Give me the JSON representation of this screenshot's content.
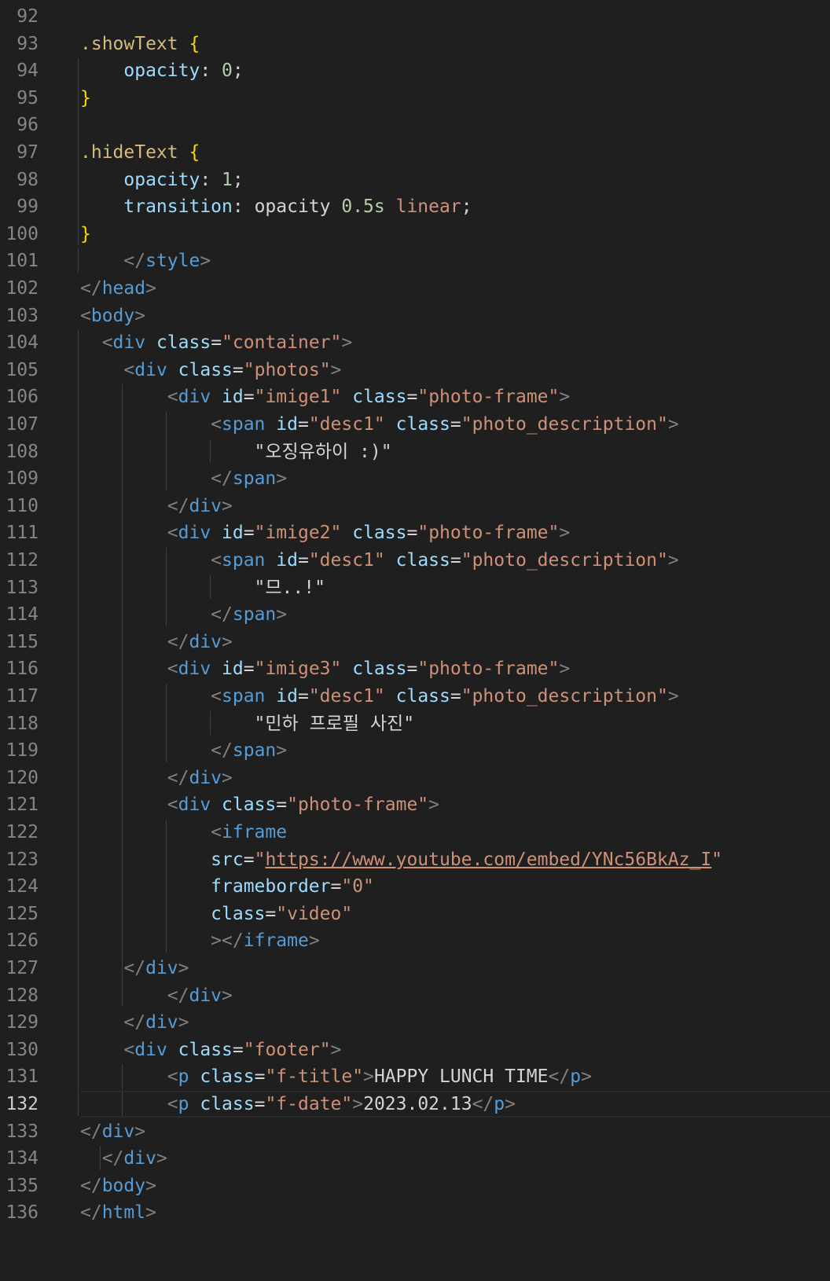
{
  "editor": {
    "active_line": "132",
    "lines": [
      {
        "n": "92",
        "t": []
      },
      {
        "n": "93",
        "t": [
          [
            "sel",
            ".showText "
          ],
          [
            "br",
            "{"
          ]
        ]
      },
      {
        "n": "94",
        "t": [
          [
            "prop",
            "    opacity"
          ],
          [
            "txt",
            ": "
          ],
          [
            "num",
            "0"
          ],
          [
            "txt",
            ";"
          ]
        ]
      },
      {
        "n": "95",
        "t": [
          [
            "br",
            "}"
          ]
        ]
      },
      {
        "n": "96",
        "t": []
      },
      {
        "n": "97",
        "t": [
          [
            "sel",
            ".hideText "
          ],
          [
            "br",
            "{"
          ]
        ]
      },
      {
        "n": "98",
        "t": [
          [
            "prop",
            "    opacity"
          ],
          [
            "txt",
            ": "
          ],
          [
            "num",
            "1"
          ],
          [
            "txt",
            ";"
          ]
        ]
      },
      {
        "n": "99",
        "t": [
          [
            "prop",
            "    transition"
          ],
          [
            "txt",
            ": opacity "
          ],
          [
            "num",
            "0.5s"
          ],
          [
            "txt",
            " "
          ],
          [
            "val",
            "linear"
          ],
          [
            "txt",
            ";"
          ]
        ]
      },
      {
        "n": "100",
        "t": [
          [
            "br",
            "}"
          ]
        ]
      },
      {
        "n": "101",
        "t": [
          [
            "pun",
            "    </"
          ],
          [
            "tag",
            "style"
          ],
          [
            "pun",
            ">"
          ]
        ]
      },
      {
        "n": "102",
        "t": [
          [
            "pun",
            "</"
          ],
          [
            "tag",
            "head"
          ],
          [
            "pun",
            ">"
          ]
        ]
      },
      {
        "n": "103",
        "t": [
          [
            "pun",
            "<"
          ],
          [
            "tag",
            "body"
          ],
          [
            "pun",
            ">"
          ]
        ]
      },
      {
        "n": "104",
        "t": [
          [
            "pun",
            "  <"
          ],
          [
            "tag",
            "div"
          ],
          [
            "txt",
            " "
          ],
          [
            "att",
            "class"
          ],
          [
            "txt",
            "="
          ],
          [
            "str",
            "\"container\""
          ],
          [
            "pun",
            ">"
          ]
        ]
      },
      {
        "n": "105",
        "t": [
          [
            "pun",
            "    <"
          ],
          [
            "tag",
            "div"
          ],
          [
            "txt",
            " "
          ],
          [
            "att",
            "class"
          ],
          [
            "txt",
            "="
          ],
          [
            "str",
            "\"photos\""
          ],
          [
            "pun",
            ">"
          ]
        ]
      },
      {
        "n": "106",
        "t": [
          [
            "pun",
            "        <"
          ],
          [
            "tag",
            "div"
          ],
          [
            "txt",
            " "
          ],
          [
            "att",
            "id"
          ],
          [
            "txt",
            "="
          ],
          [
            "str",
            "\"imige1\""
          ],
          [
            "txt",
            " "
          ],
          [
            "att",
            "class"
          ],
          [
            "txt",
            "="
          ],
          [
            "str",
            "\"photo-frame\""
          ],
          [
            "pun",
            ">"
          ]
        ]
      },
      {
        "n": "107",
        "t": [
          [
            "pun",
            "            <"
          ],
          [
            "tag",
            "span"
          ],
          [
            "txt",
            " "
          ],
          [
            "att",
            "id"
          ],
          [
            "txt",
            "="
          ],
          [
            "str",
            "\"desc1\""
          ],
          [
            "txt",
            " "
          ],
          [
            "att",
            "class"
          ],
          [
            "txt",
            "="
          ],
          [
            "str",
            "\"photo_description\""
          ],
          [
            "pun",
            ">"
          ]
        ]
      },
      {
        "n": "108",
        "t": [
          [
            "txt",
            "                \"오징유하이 :)\""
          ]
        ]
      },
      {
        "n": "109",
        "t": [
          [
            "pun",
            "            </"
          ],
          [
            "tag",
            "span"
          ],
          [
            "pun",
            ">"
          ]
        ]
      },
      {
        "n": "110",
        "t": [
          [
            "pun",
            "        </"
          ],
          [
            "tag",
            "div"
          ],
          [
            "pun",
            ">"
          ]
        ]
      },
      {
        "n": "111",
        "t": [
          [
            "pun",
            "        <"
          ],
          [
            "tag",
            "div"
          ],
          [
            "txt",
            " "
          ],
          [
            "att",
            "id"
          ],
          [
            "txt",
            "="
          ],
          [
            "str",
            "\"imige2\""
          ],
          [
            "txt",
            " "
          ],
          [
            "att",
            "class"
          ],
          [
            "txt",
            "="
          ],
          [
            "str",
            "\"photo-frame\""
          ],
          [
            "pun",
            ">"
          ]
        ]
      },
      {
        "n": "112",
        "t": [
          [
            "pun",
            "            <"
          ],
          [
            "tag",
            "span"
          ],
          [
            "txt",
            " "
          ],
          [
            "att",
            "id"
          ],
          [
            "txt",
            "="
          ],
          [
            "str",
            "\"desc1\""
          ],
          [
            "txt",
            " "
          ],
          [
            "att",
            "class"
          ],
          [
            "txt",
            "="
          ],
          [
            "str",
            "\"photo_description\""
          ],
          [
            "pun",
            ">"
          ]
        ]
      },
      {
        "n": "113",
        "t": [
          [
            "txt",
            "                \"므..!\""
          ]
        ]
      },
      {
        "n": "114",
        "t": [
          [
            "pun",
            "            </"
          ],
          [
            "tag",
            "span"
          ],
          [
            "pun",
            ">"
          ]
        ]
      },
      {
        "n": "115",
        "t": [
          [
            "pun",
            "        </"
          ],
          [
            "tag",
            "div"
          ],
          [
            "pun",
            ">"
          ]
        ]
      },
      {
        "n": "116",
        "t": [
          [
            "pun",
            "        <"
          ],
          [
            "tag",
            "div"
          ],
          [
            "txt",
            " "
          ],
          [
            "att",
            "id"
          ],
          [
            "txt",
            "="
          ],
          [
            "str",
            "\"imige3\""
          ],
          [
            "txt",
            " "
          ],
          [
            "att",
            "class"
          ],
          [
            "txt",
            "="
          ],
          [
            "str",
            "\"photo-frame\""
          ],
          [
            "pun",
            ">"
          ]
        ]
      },
      {
        "n": "117",
        "t": [
          [
            "pun",
            "            <"
          ],
          [
            "tag",
            "span"
          ],
          [
            "txt",
            " "
          ],
          [
            "att",
            "id"
          ],
          [
            "txt",
            "="
          ],
          [
            "str",
            "\"desc1\""
          ],
          [
            "txt",
            " "
          ],
          [
            "att",
            "class"
          ],
          [
            "txt",
            "="
          ],
          [
            "str",
            "\"photo_description\""
          ],
          [
            "pun",
            ">"
          ]
        ]
      },
      {
        "n": "118",
        "t": [
          [
            "txt",
            "                \"민하 프로필 사진\""
          ]
        ]
      },
      {
        "n": "119",
        "t": [
          [
            "pun",
            "            </"
          ],
          [
            "tag",
            "span"
          ],
          [
            "pun",
            ">"
          ]
        ]
      },
      {
        "n": "120",
        "t": [
          [
            "pun",
            "        </"
          ],
          [
            "tag",
            "div"
          ],
          [
            "pun",
            ">"
          ]
        ]
      },
      {
        "n": "121",
        "t": [
          [
            "pun",
            "        <"
          ],
          [
            "tag",
            "div"
          ],
          [
            "txt",
            " "
          ],
          [
            "att",
            "class"
          ],
          [
            "txt",
            "="
          ],
          [
            "str",
            "\"photo-frame\""
          ],
          [
            "pun",
            ">"
          ]
        ]
      },
      {
        "n": "122",
        "t": [
          [
            "pun",
            "            <"
          ],
          [
            "tag",
            "iframe"
          ]
        ]
      },
      {
        "n": "123",
        "t": [
          [
            "att",
            "            src"
          ],
          [
            "txt",
            "="
          ],
          [
            "str",
            "\""
          ],
          [
            "url",
            "https://www.youtube.com/embed/YNc56BkAz_I"
          ],
          [
            "str",
            "\""
          ]
        ]
      },
      {
        "n": "124",
        "t": [
          [
            "att",
            "            frameborder"
          ],
          [
            "txt",
            "="
          ],
          [
            "str",
            "\"0\""
          ]
        ]
      },
      {
        "n": "125",
        "t": [
          [
            "att",
            "            class"
          ],
          [
            "txt",
            "="
          ],
          [
            "str",
            "\"video\""
          ]
        ]
      },
      {
        "n": "126",
        "t": [
          [
            "pun",
            "            ></"
          ],
          [
            "tag",
            "iframe"
          ],
          [
            "pun",
            ">"
          ]
        ]
      },
      {
        "n": "127",
        "t": [
          [
            "pun",
            "    </"
          ],
          [
            "tag",
            "div"
          ],
          [
            "pun",
            ">"
          ]
        ]
      },
      {
        "n": "128",
        "t": [
          [
            "pun",
            "        </"
          ],
          [
            "tag",
            "div"
          ],
          [
            "pun",
            ">"
          ]
        ]
      },
      {
        "n": "129",
        "t": [
          [
            "pun",
            "    </"
          ],
          [
            "tag",
            "div"
          ],
          [
            "pun",
            ">"
          ]
        ]
      },
      {
        "n": "130",
        "t": [
          [
            "pun",
            "    <"
          ],
          [
            "tag",
            "div"
          ],
          [
            "txt",
            " "
          ],
          [
            "att",
            "class"
          ],
          [
            "txt",
            "="
          ],
          [
            "str",
            "\"footer\""
          ],
          [
            "pun",
            ">"
          ]
        ]
      },
      {
        "n": "131",
        "t": [
          [
            "pun",
            "        <"
          ],
          [
            "tag",
            "p"
          ],
          [
            "txt",
            " "
          ],
          [
            "att",
            "class"
          ],
          [
            "txt",
            "="
          ],
          [
            "str",
            "\"f-title\""
          ],
          [
            "pun",
            ">"
          ],
          [
            "txt",
            "HAPPY LUNCH TIME"
          ],
          [
            "pun",
            "</"
          ],
          [
            "tag",
            "p"
          ],
          [
            "pun",
            ">"
          ]
        ]
      },
      {
        "n": "132",
        "t": [
          [
            "pun",
            "        <"
          ],
          [
            "tag",
            "p"
          ],
          [
            "txt",
            " "
          ],
          [
            "att",
            "class"
          ],
          [
            "txt",
            "="
          ],
          [
            "str",
            "\"f-date\""
          ],
          [
            "pun",
            ">"
          ],
          [
            "txt",
            "2023.02.13"
          ],
          [
            "pun",
            "</"
          ],
          [
            "tag",
            "p"
          ],
          [
            "pun",
            ">"
          ]
        ]
      },
      {
        "n": "133",
        "t": [
          [
            "pun",
            "</"
          ],
          [
            "tag",
            "div"
          ],
          [
            "pun",
            ">"
          ]
        ]
      },
      {
        "n": "134",
        "t": [
          [
            "pun",
            "  </"
          ],
          [
            "tag",
            "div"
          ],
          [
            "pun",
            ">"
          ]
        ]
      },
      {
        "n": "135",
        "t": [
          [
            "pun",
            "</"
          ],
          [
            "tag",
            "body"
          ],
          [
            "pun",
            ">"
          ]
        ]
      },
      {
        "n": "136",
        "t": [
          [
            "pun",
            "</"
          ],
          [
            "tag",
            "html"
          ],
          [
            "pun",
            ">"
          ]
        ]
      }
    ]
  }
}
